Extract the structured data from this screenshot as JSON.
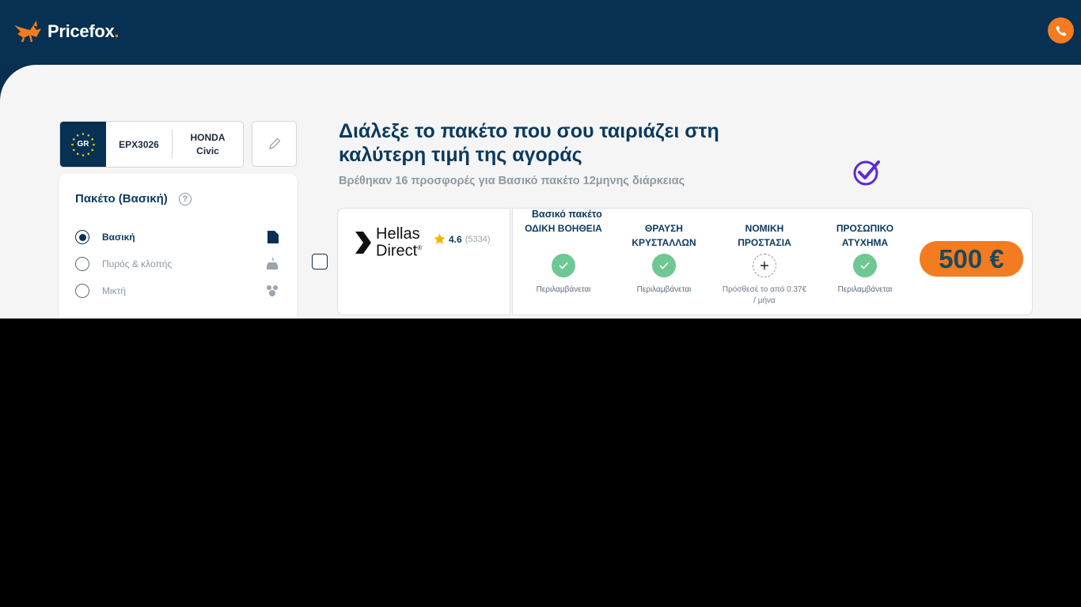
{
  "header": {
    "brand": "Pricefox",
    "brand_dot": ".",
    "phone_icon": "phone-icon"
  },
  "vehicle": {
    "country_code": "GR",
    "plate": "EPX3026",
    "make": "HONDA",
    "model": "Civic",
    "edit_icon": "pencil-icon"
  },
  "package_panel": {
    "title": "Πακέτο (Βασική)",
    "help": "?",
    "options": [
      {
        "label": "Βασική",
        "selected": true,
        "icon": "document-icon"
      },
      {
        "label": "Πυρός & κλοπής",
        "selected": false,
        "icon": "car-fire-icon"
      },
      {
        "label": "Μικτή",
        "selected": false,
        "icon": "group-icon"
      }
    ]
  },
  "main": {
    "headline": "Διάλεξε το πακέτο που σου ταιριάζει στη καλύτερη τιμή της αγοράς",
    "subline": "Βρέθηκαν 16 προσφορές για Βασικό πακέτο 12μηνης διάρκειας"
  },
  "offer": {
    "provider_line1": "Hellas",
    "provider_line2": "Direct",
    "provider_mark": "®",
    "rating": "4.6",
    "reviews": "(5334)",
    "package_label": "Βασικό πακέτο",
    "covers": [
      {
        "title": "ΟΔΙΚΗ ΒΟΗΘΕΙΑ",
        "status": "included",
        "note": "Περιλαμβάνεται"
      },
      {
        "title": "ΘΡΑΥΣΗ ΚΡΥΣΤΑΛΛΩΝ",
        "status": "included",
        "note": "Περιλαμβάνεται"
      },
      {
        "title": "ΝΟΜΙΚΗ ΠΡΟΣΤΑΣΙΑ",
        "status": "addable",
        "note": "Πρόσθεσέ το από 0.37€ / μήνα"
      },
      {
        "title": "ΠΡΟΣΩΠΙΚΟ ΑΤΥΧΗΜΑ",
        "status": "included",
        "note": "Περιλαμβάνεται"
      }
    ],
    "price": "500 €"
  },
  "colors": {
    "navy": "#063152",
    "orange": "#f47b20",
    "green": "#6fc794",
    "purple_check": "#5b2bd6"
  }
}
